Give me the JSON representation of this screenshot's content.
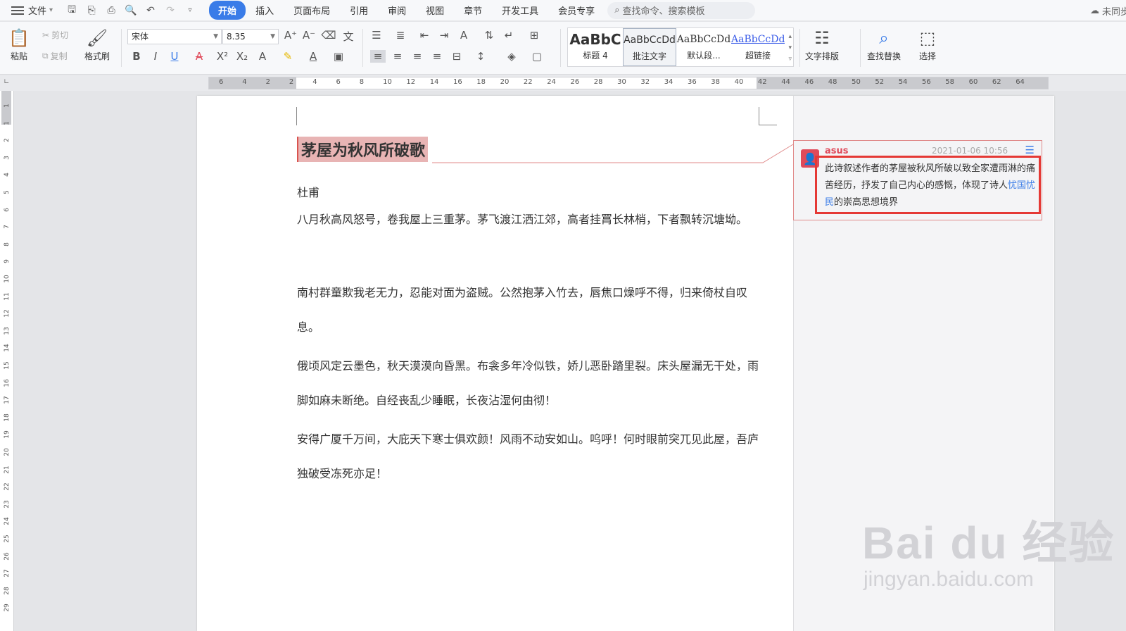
{
  "menubar": {
    "file": "文件",
    "tabs": [
      "开始",
      "插入",
      "页面布局",
      "引用",
      "审阅",
      "视图",
      "章节",
      "开发工具",
      "会员专享"
    ],
    "search_placeholder": "查找命令、搜索模板",
    "cloud_status": "未同步"
  },
  "ribbon": {
    "paste": "粘贴",
    "cut": "剪切",
    "copy": "复制",
    "format_painter": "格式刷",
    "font_name": "宋体",
    "font_size": "8.35",
    "styles": [
      {
        "preview": "AaBbC",
        "name": "标题 4"
      },
      {
        "preview": "AaBbCcDd",
        "name": "批注文字"
      },
      {
        "preview": "AaBbCcDd",
        "name": "默认段..."
      },
      {
        "preview": "AaBbCcDd",
        "name": "超链接"
      }
    ],
    "text_layout": "文字排版",
    "find_replace": "查找替换",
    "select": "选择"
  },
  "ruler": {
    "h_labels": [
      "6",
      "4",
      "2",
      "2",
      "4",
      "6",
      "8",
      "10",
      "12",
      "14",
      "16",
      "18",
      "20",
      "22",
      "24",
      "26",
      "28",
      "30",
      "32",
      "34",
      "36",
      "38",
      "40",
      "42",
      "44",
      "46",
      "48",
      "50",
      "52",
      "54",
      "56",
      "58",
      "60",
      "62",
      "64"
    ],
    "v_labels": [
      "1",
      "1",
      "2",
      "3",
      "4",
      "5",
      "6",
      "7",
      "8",
      "9",
      "10",
      "11",
      "12",
      "13",
      "14",
      "15",
      "16",
      "17",
      "18",
      "19",
      "20",
      "21",
      "22",
      "23",
      "24",
      "25",
      "26",
      "27",
      "28",
      "29"
    ]
  },
  "document": {
    "title": "茅屋为秋风所破歌",
    "author": "杜甫",
    "paragraphs": [
      "八月秋高风怒号，卷我屋上三重茅。茅飞渡江洒江郊，高者挂罥长林梢，下者飘转沉塘坳。",
      "南村群童欺我老无力，忍能对面为盗贼。公然抱茅入竹去，唇焦口燥呼不得，归来倚杖自叹息。",
      "俄顷风定云墨色，秋天漠漠向昏黑。布衾多年冷似铁，娇儿恶卧踏里裂。床头屋漏无干处，雨脚如麻未断绝。自经丧乱少睡眠，长夜沾湿何由彻！",
      "安得广厦千万间，大庇天下寒士俱欢颜！风雨不动安如山。呜呼！何时眼前突兀见此屋，吾庐独破受冻死亦足！"
    ]
  },
  "comment": {
    "author": "asus",
    "time": "2021-01-06 10:56",
    "text_before": "此诗叙述作者的茅屋被秋风所破以致全家遭雨淋的痛苦经历，抒发了自己内心的感慨，体现了诗人",
    "text_highlight": "忧国忧民",
    "text_after": "的崇高思想境界"
  },
  "watermark": {
    "brand": "Bai du 经验",
    "url": "jingyan.baidu.com"
  },
  "colors": {
    "accent": "#3a7ce8",
    "comment_red": "#e53935",
    "title_highlight": "#e8b4b4"
  }
}
